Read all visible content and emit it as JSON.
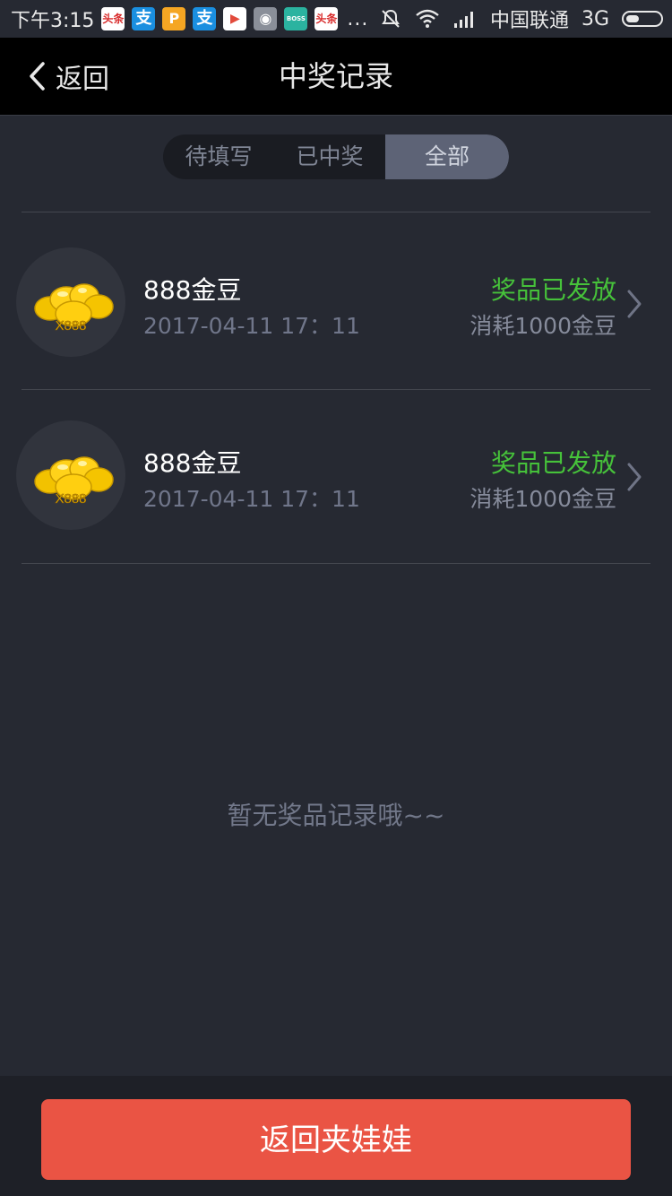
{
  "status_bar": {
    "time": "下午3:15",
    "carrier": "中国联通",
    "network": "3G",
    "dots": "...",
    "app_icons": [
      {
        "name": "toutiao-icon",
        "glyph": "头条",
        "color": "#d82a2a"
      },
      {
        "name": "alipay-icon",
        "glyph": "支",
        "color": "#1a8fe0"
      },
      {
        "name": "orange-app-icon",
        "glyph": "P",
        "color": "#f5a623"
      },
      {
        "name": "alipay-icon-2",
        "glyph": "支",
        "color": "#1a8fe0"
      },
      {
        "name": "play-store-icon",
        "glyph": "▶",
        "color": "#ffffff"
      },
      {
        "name": "gray-app-icon",
        "glyph": "◉",
        "color": "#8a8f99"
      },
      {
        "name": "boss-zhipin-icon",
        "glyph": "BOSS",
        "color": "#2bb3a0"
      },
      {
        "name": "toutiao-icon-2",
        "glyph": "头条",
        "color": "#d82a2a"
      }
    ]
  },
  "header": {
    "back_label": "返回",
    "title": "中奖记录"
  },
  "tabs": [
    {
      "label": "待填写",
      "active": false
    },
    {
      "label": "已中奖",
      "active": false
    },
    {
      "label": "全部",
      "active": true
    }
  ],
  "records": [
    {
      "name": "888金豆",
      "time": "2017-04-11 17：11",
      "status": "奖品已发放",
      "cost": "消耗1000金豆",
      "badge": "X888"
    },
    {
      "name": "888金豆",
      "time": "2017-04-11 17：11",
      "status": "奖品已发放",
      "cost": "消耗1000金豆",
      "badge": "X888"
    }
  ],
  "empty_message": "暂无奖品记录哦~~",
  "cta_label": "返回夹娃娃",
  "colors": {
    "background": "#262932",
    "status_green": "#46c23a",
    "cta": "#ea5444"
  }
}
